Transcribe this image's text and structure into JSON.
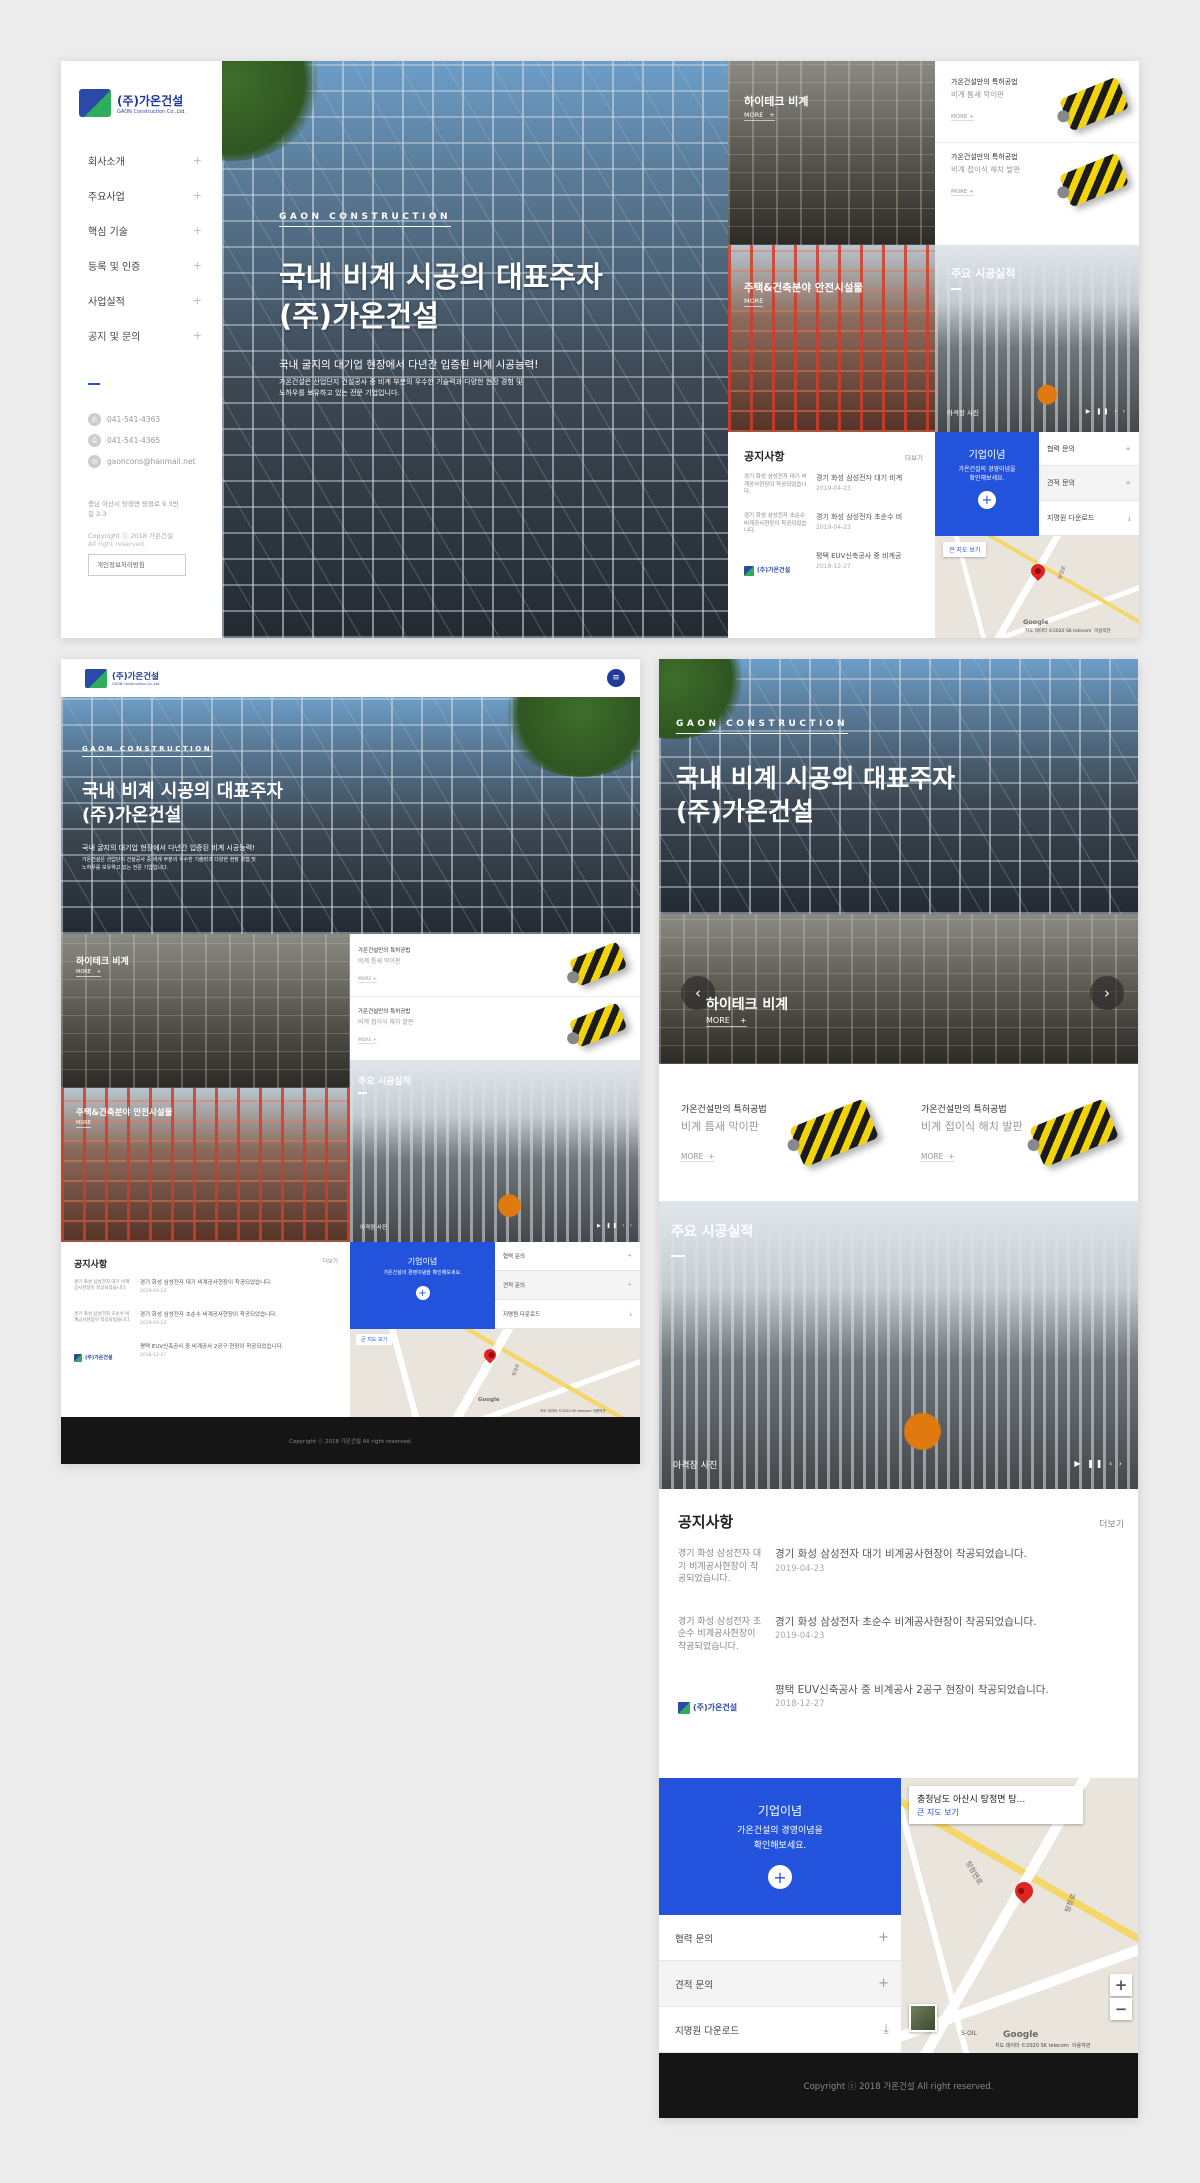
{
  "brand": {
    "name": "(주)가온건설",
    "sub": "GAON Construction Co.,Ltd.",
    "mini": "(주)가온건설"
  },
  "nav": [
    {
      "label": "회사소개"
    },
    {
      "label": "주요사업"
    },
    {
      "label": "핵심 기술"
    },
    {
      "label": "등록 및 인증"
    },
    {
      "label": "사업실적"
    },
    {
      "label": "공지 및 문의"
    }
  ],
  "contact": {
    "phone": "041-541-4363",
    "fax": "041-541-4365",
    "email": "gaoncons@hanmail.net"
  },
  "address": "충남 아산시 탕정면 탕정로 9 3번길 2-3",
  "copyright": "Copyright ⓒ 2018 가온건설",
  "rights": "All right reserved.",
  "privacy": "개인정보처리방침",
  "footer_copyright": "Copyright ⓒ 2018 가온건설 All right reserved.",
  "hero": {
    "eyebrow": "GAON CONSTRUCTION",
    "title1": "국내 비계 시공의 대표주자",
    "title2": "(주)가온건설",
    "sub": "국내 굴지의 대기업 현장에서 다년간 입증된 비계 시공능력!",
    "body1": "가온건설은 산업단지 건설공사 중 비계 부분의 우수한 기술력과 다양한 현장 경험 및",
    "body2": "노하우를 보유하고 있는 전문 기업입니다."
  },
  "hitech": {
    "title": "하이테크 비계",
    "more": "MORE"
  },
  "safety": {
    "title": "주택&건축분야 안전시설물",
    "more": "MORE"
  },
  "patents": [
    {
      "title": "가온건설만의 특허공법",
      "sub": "비계 틈새 막이판",
      "more": "MORE"
    },
    {
      "title": "가온건설만의 특허공법",
      "sub": "비계 접이식 해치 발판",
      "more": "MORE"
    }
  ],
  "works": {
    "title": "주요 시공실적",
    "caption": "아격장 사진",
    "controls": "▶ ❚❚ ‹ ›"
  },
  "notice": {
    "title": "공지사항",
    "more": "더보기",
    "items": [
      {
        "thumb": "경기 화성 삼성전자 대기 비계공사현장이 착공되었습니다.",
        "title_short": "경기 화성 삼성전자 대기 비계",
        "title": "경기 화성 삼성전자 대기 비계공사현장이 착공되었습니다.",
        "date": "2019-04-23"
      },
      {
        "thumb": "경기 화성 삼성전자 초순수 비계공사현장이 착공되었습니다.",
        "title_short": "경기 화성 삼성전자 초순수 비",
        "title": "경기 화성 삼성전자 초순수 비계공사현장이 착공되었습니다.",
        "date": "2019-04-23"
      },
      {
        "thumb": "",
        "title_short": "평택 EUV신축공사 중 비계공",
        "title": "평택 EUV신축공사 중 비계공사 2공구 현장이 착공되었습니다.",
        "date": "2018-12-27"
      }
    ]
  },
  "ideology": {
    "title": "기업이념",
    "line1": "가온건설의 경영이념을",
    "line2": "확인해보세요.",
    "inline": "가온건설의 경영이념을 확인해보세요.",
    "plus": "+"
  },
  "services": [
    {
      "label": "협력 문의",
      "icon": "+"
    },
    {
      "label": "견적 문의",
      "icon": "+"
    },
    {
      "label": "지명원 다운로드",
      "icon": "⤓"
    }
  ],
  "map": {
    "place": "충청남도 아산시 탕정면 탕...",
    "link": "큰 지도 보기",
    "attribution": "지도 데이터 ©2020 SK telecom",
    "terms": "이용약관",
    "google": "Google",
    "zoom_in": "+",
    "zoom_out": "−",
    "road1": "탕정로",
    "road2": "탕정면로",
    "station": "S-OIL"
  },
  "colors": {
    "accent": "#2353dc",
    "footer": "#151515",
    "hero_text": "#ffffff"
  }
}
